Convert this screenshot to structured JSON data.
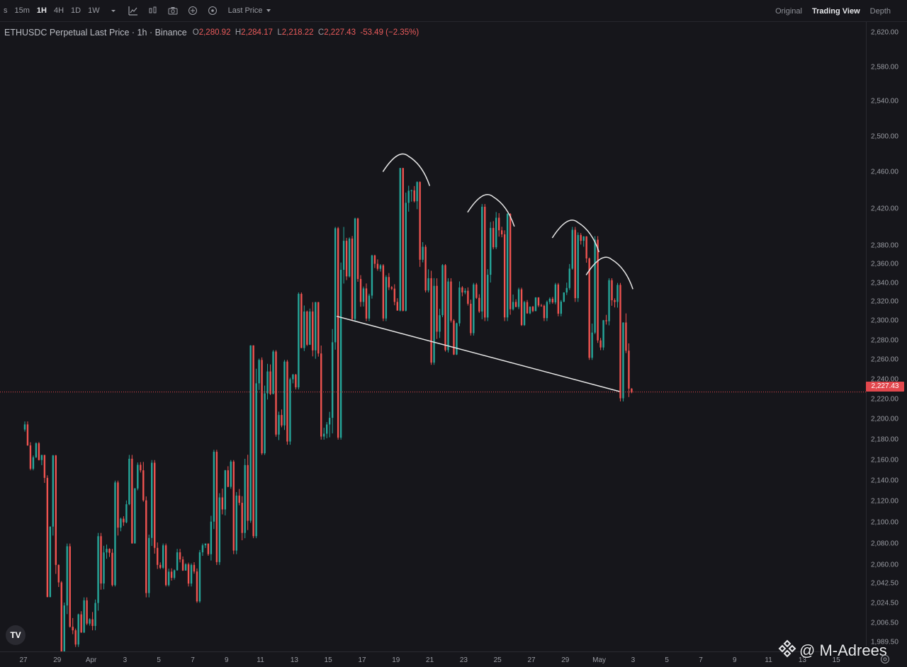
{
  "toolbar": {
    "timeframes": [
      {
        "label": "s",
        "active": false
      },
      {
        "label": "15m",
        "active": false
      },
      {
        "label": "1H",
        "active": true
      },
      {
        "label": "4H",
        "active": false
      },
      {
        "label": "1D",
        "active": false
      },
      {
        "label": "1W",
        "active": false
      }
    ],
    "icons": [
      "chevron-down-icon",
      "indicators-icon",
      "chart-type-icon",
      "camera-icon",
      "add-icon",
      "replay-icon"
    ],
    "price_source": "Last Price",
    "views": [
      {
        "label": "Original",
        "active": false
      },
      {
        "label": "Trading View",
        "active": true
      },
      {
        "label": "Depth",
        "active": false
      }
    ]
  },
  "legend": {
    "symbol": "ETHUSDC Perpetual Last Price · 1h · Binance",
    "open_label": "O",
    "open": "2,280.92",
    "high_label": "H",
    "high": "2,284.17",
    "low_label": "L",
    "low": "2,218.22",
    "close_label": "C",
    "close": "2,227.43",
    "change": "-53.49 (−2.35%)"
  },
  "price_axis": {
    "labels": [
      "2,620.00",
      "2,580.00",
      "2,540.00",
      "2,500.00",
      "2,460.00",
      "2,420.00",
      "2,380.00",
      "2,360.00",
      "2,340.00",
      "2,320.00",
      "2,300.00",
      "2,280.00",
      "2,260.00",
      "2,240.00",
      "2,220.00",
      "2,200.00",
      "2,180.00",
      "2,160.00",
      "2,140.00",
      "2,120.00",
      "2,100.00",
      "2,080.00",
      "2,060.00",
      "2,042.50",
      "2,024.50",
      "2,006.50",
      "1,989.50"
    ],
    "current_price": "2,227.43",
    "current_price_color": "#e2474d"
  },
  "time_axis": {
    "labels": [
      "27",
      "29",
      "Apr",
      "3",
      "5",
      "7",
      "9",
      "11",
      "13",
      "15",
      "17",
      "19",
      "21",
      "23",
      "25",
      "27",
      "29",
      "May",
      "3",
      "5",
      "7",
      "9",
      "11",
      "13",
      "15"
    ]
  },
  "colors": {
    "up": "#26a69a",
    "down": "#ef5350",
    "background": "#16161b",
    "drawing": "#e6e6e6",
    "price_line": "#e2474d"
  },
  "chart_data": {
    "type": "candlestick",
    "series": [
      {
        "date": "Mar 27",
        "open": 2190,
        "high": 2198,
        "low": 2150,
        "close": 2160
      },
      {
        "date": "Mar 28",
        "open": 2160,
        "high": 2165,
        "low": 2030,
        "close": 2060
      },
      {
        "date": "Mar 29",
        "open": 2060,
        "high": 2080,
        "low": 1980,
        "close": 2000
      },
      {
        "date": "Mar 30",
        "open": 2000,
        "high": 2030,
        "low": 1985,
        "close": 2010
      },
      {
        "date": "Mar 31",
        "open": 2010,
        "high": 2090,
        "low": 2000,
        "close": 2075
      },
      {
        "date": "Apr 1",
        "open": 2075,
        "high": 2140,
        "low": 2040,
        "close": 2100
      },
      {
        "date": "Apr 2",
        "open": 2100,
        "high": 2165,
        "low": 2080,
        "close": 2150
      },
      {
        "date": "Apr 3",
        "open": 2150,
        "high": 2160,
        "low": 2030,
        "close": 2060
      },
      {
        "date": "Apr 4",
        "open": 2060,
        "high": 2080,
        "low": 2040,
        "close": 2055
      },
      {
        "date": "Apr 5",
        "open": 2055,
        "high": 2075,
        "low": 2040,
        "close": 2060
      },
      {
        "date": "Apr 6",
        "open": 2060,
        "high": 2080,
        "low": 2025,
        "close": 2070
      },
      {
        "date": "Apr 7",
        "open": 2070,
        "high": 2170,
        "low": 2060,
        "close": 2150
      },
      {
        "date": "Apr 8",
        "open": 2150,
        "high": 2160,
        "low": 2070,
        "close": 2090
      },
      {
        "date": "Apr 9",
        "open": 2090,
        "high": 2275,
        "low": 2085,
        "close": 2260
      },
      {
        "date": "Apr 10",
        "open": 2260,
        "high": 2270,
        "low": 2165,
        "close": 2185
      },
      {
        "date": "Apr 11",
        "open": 2185,
        "high": 2260,
        "low": 2175,
        "close": 2245
      },
      {
        "date": "Apr 12",
        "open": 2245,
        "high": 2330,
        "low": 2230,
        "close": 2310
      },
      {
        "date": "Apr 13",
        "open": 2310,
        "high": 2320,
        "low": 2180,
        "close": 2195
      },
      {
        "date": "Apr 14",
        "open": 2195,
        "high": 2400,
        "low": 2180,
        "close": 2385
      },
      {
        "date": "Apr 15",
        "open": 2385,
        "high": 2410,
        "low": 2300,
        "close": 2320
      },
      {
        "date": "Apr 16",
        "open": 2320,
        "high": 2370,
        "low": 2300,
        "close": 2355
      },
      {
        "date": "Apr 17",
        "open": 2355,
        "high": 2360,
        "low": 2300,
        "close": 2320
      },
      {
        "date": "Apr 18",
        "open": 2320,
        "high": 2465,
        "low": 2310,
        "close": 2440
      },
      {
        "date": "Apr 19",
        "open": 2440,
        "high": 2450,
        "low": 2330,
        "close": 2345
      },
      {
        "date": "Apr 20",
        "open": 2345,
        "high": 2360,
        "low": 2255,
        "close": 2270
      },
      {
        "date": "Apr 21",
        "open": 2270,
        "high": 2345,
        "low": 2265,
        "close": 2330
      },
      {
        "date": "Apr 22",
        "open": 2330,
        "high": 2340,
        "low": 2285,
        "close": 2310
      },
      {
        "date": "Apr 23",
        "open": 2310,
        "high": 2425,
        "low": 2300,
        "close": 2410
      },
      {
        "date": "Apr 24",
        "open": 2410,
        "high": 2415,
        "low": 2300,
        "close": 2320
      },
      {
        "date": "Apr 25",
        "open": 2320,
        "high": 2335,
        "low": 2295,
        "close": 2315
      },
      {
        "date": "Apr 26",
        "open": 2315,
        "high": 2325,
        "low": 2300,
        "close": 2320
      },
      {
        "date": "Apr 27",
        "open": 2320,
        "high": 2340,
        "low": 2305,
        "close": 2330
      },
      {
        "date": "Apr 28",
        "open": 2330,
        "high": 2400,
        "low": 2320,
        "close": 2385
      },
      {
        "date": "Apr 29",
        "open": 2385,
        "high": 2390,
        "low": 2260,
        "close": 2280
      },
      {
        "date": "Apr 30",
        "open": 2280,
        "high": 2345,
        "low": 2270,
        "close": 2320
      },
      {
        "date": "May 1",
        "open": 2320,
        "high": 2340,
        "low": 2218,
        "close": 2227
      }
    ],
    "ylim": [
      1981,
      2633
    ],
    "log_scale": true,
    "grid": false,
    "annotations": [
      {
        "type": "trendline",
        "from": {
          "date": "Apr 14",
          "price": 2305
        },
        "to": {
          "date": "May 1",
          "price": 2228
        }
      },
      {
        "type": "arc",
        "peak": {
          "date": "Apr 18",
          "price": 2478
        }
      },
      {
        "type": "arc",
        "peak": {
          "date": "Apr 23",
          "price": 2433
        }
      },
      {
        "type": "arc",
        "peak": {
          "date": "Apr 28",
          "price": 2405
        }
      },
      {
        "type": "arc",
        "peak": {
          "date": "Apr 30",
          "price": 2365
        }
      }
    ]
  },
  "watermark": {
    "text": "@ M-Adrees"
  },
  "branding": {
    "logo": "TV"
  }
}
